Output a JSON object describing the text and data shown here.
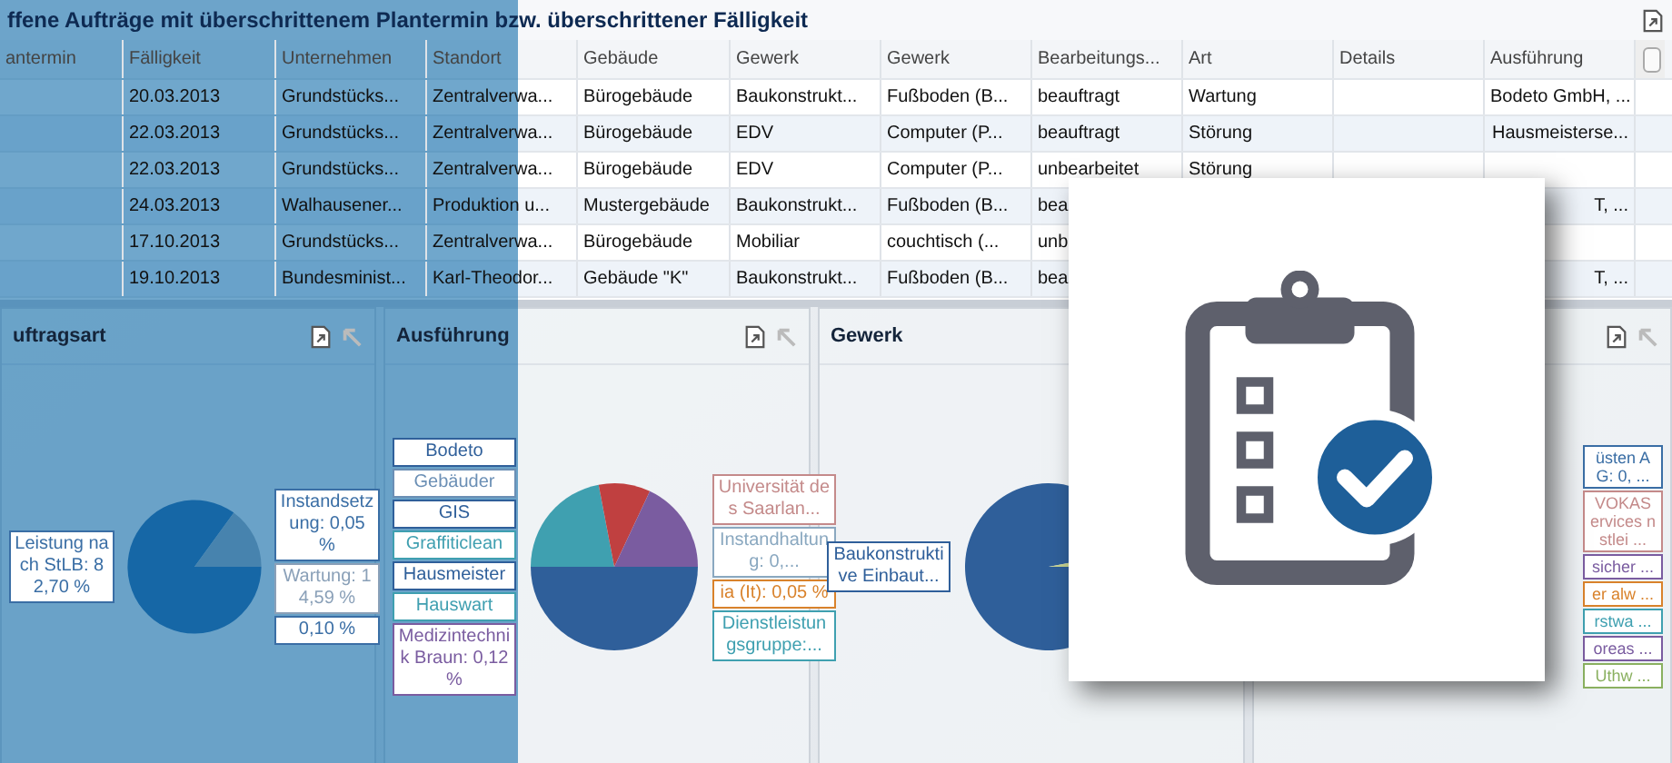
{
  "title": "ffene Aufträge mit überschrittenem Plantermin bzw. überschrittener Fälligkeit",
  "table": {
    "columns": [
      "antermin",
      "Fälligkeit",
      "Unternehmen",
      "Standort",
      "Gebäude",
      "Gewerk",
      "Gewerk",
      "Bearbeitungs...",
      "Art",
      "Details",
      "Ausführung"
    ],
    "rows": [
      [
        "",
        "20.03.2013",
        "Grundstücks...",
        "Zentralverwa...",
        "Bürogebäude",
        "Baukonstrukt...",
        "Fußboden (B...",
        "beauftragt",
        "Wartung",
        "",
        "Bodeto GmbH, ..."
      ],
      [
        "",
        "22.03.2013",
        "Grundstücks...",
        "Zentralverwa...",
        "Bürogebäude",
        "EDV",
        "Computer (P...",
        "beauftragt",
        "Störung",
        "",
        "Hausmeisterse..."
      ],
      [
        "",
        "22.03.2013",
        "Grundstücks...",
        "Zentralverwa...",
        "Bürogebäude",
        "EDV",
        "Computer (P...",
        "unbearbeitet",
        "Störung",
        "",
        ""
      ],
      [
        "",
        "24.03.2013",
        "Walhausener...",
        "Produktion u...",
        "Mustergebäude",
        "Baukonstrukt...",
        "Fußboden (B...",
        "bea",
        "",
        "",
        "T, ..."
      ],
      [
        "",
        "17.10.2013",
        "Grundstücks...",
        "Zentralverwa...",
        "Bürogebäude",
        "Mobiliar",
        "couchtisch (...",
        "unb",
        "",
        "",
        ""
      ],
      [
        "",
        "19.10.2013",
        "Bundesminist...",
        "Karl-Theodor...",
        "Gebäude \"K\"",
        "Baukonstrukt...",
        "Fußboden (B...",
        "bea",
        "",
        "",
        "T, ..."
      ]
    ]
  },
  "panels": [
    {
      "title": "uftragsart",
      "labels_left": [
        {
          "text": "Leistung nach StLB: 82,70 %",
          "color": "#3a6ea5"
        }
      ],
      "labels_right": [
        {
          "text": "Instandsetzung: 0,05 %",
          "color": "#3a6ea5"
        },
        {
          "text": "Wartung: 14,59 %",
          "color": "#8aa0b8"
        },
        {
          "text": "0,10 %",
          "color": "#3a6ea5"
        }
      ]
    },
    {
      "title": "Ausführung",
      "labels_left": [
        {
          "text": "Bodeto",
          "color": "#2f5f9a"
        },
        {
          "text": "Gebäuder",
          "color": "#6b8fb5"
        },
        {
          "text": "GIS",
          "color": "#2f5f9a"
        },
        {
          "text": "Graffiticlean",
          "color": "#3f9fb0"
        },
        {
          "text": "Hausmeister",
          "color": "#2f5f9a"
        },
        {
          "text": "Hauswart",
          "color": "#3f9fb0"
        },
        {
          "text": "Medizintechnik Braun: 0,12 %",
          "color": "#7a5ca0"
        }
      ],
      "labels_right": [
        {
          "text": "Universität des Saarlan...",
          "color": "#c48a8a"
        },
        {
          "text": "Instandhaltung: 0,...",
          "color": "#8aa8c0"
        },
        {
          "text": "ia (It): 0,05 %",
          "color": "#d9822b"
        },
        {
          "text": "Dienstleistungsgruppe:...",
          "color": "#3fa0b0"
        }
      ]
    },
    {
      "title": "Gewerk",
      "labels_left": [
        {
          "text": "Baukonstruktive Einbaut...",
          "color": "#2f5f9a"
        }
      ]
    },
    {
      "labels_right": [
        {
          "text": "üsten AG: 0, ...",
          "color": "#3a6ea5"
        },
        {
          "text": "VOKAS ervices nstlei ...",
          "color": "#c48a8a"
        },
        {
          "text": "sicher ...",
          "color": "#7a5ca0"
        },
        {
          "text": "er alw ...",
          "color": "#d9822b"
        },
        {
          "text": "rstwa ...",
          "color": "#3fa0b0"
        },
        {
          "text": "oreas ...",
          "color": "#7a5ca0"
        },
        {
          "text": "Uthw ...",
          "color": "#8ab060"
        }
      ]
    }
  ]
}
